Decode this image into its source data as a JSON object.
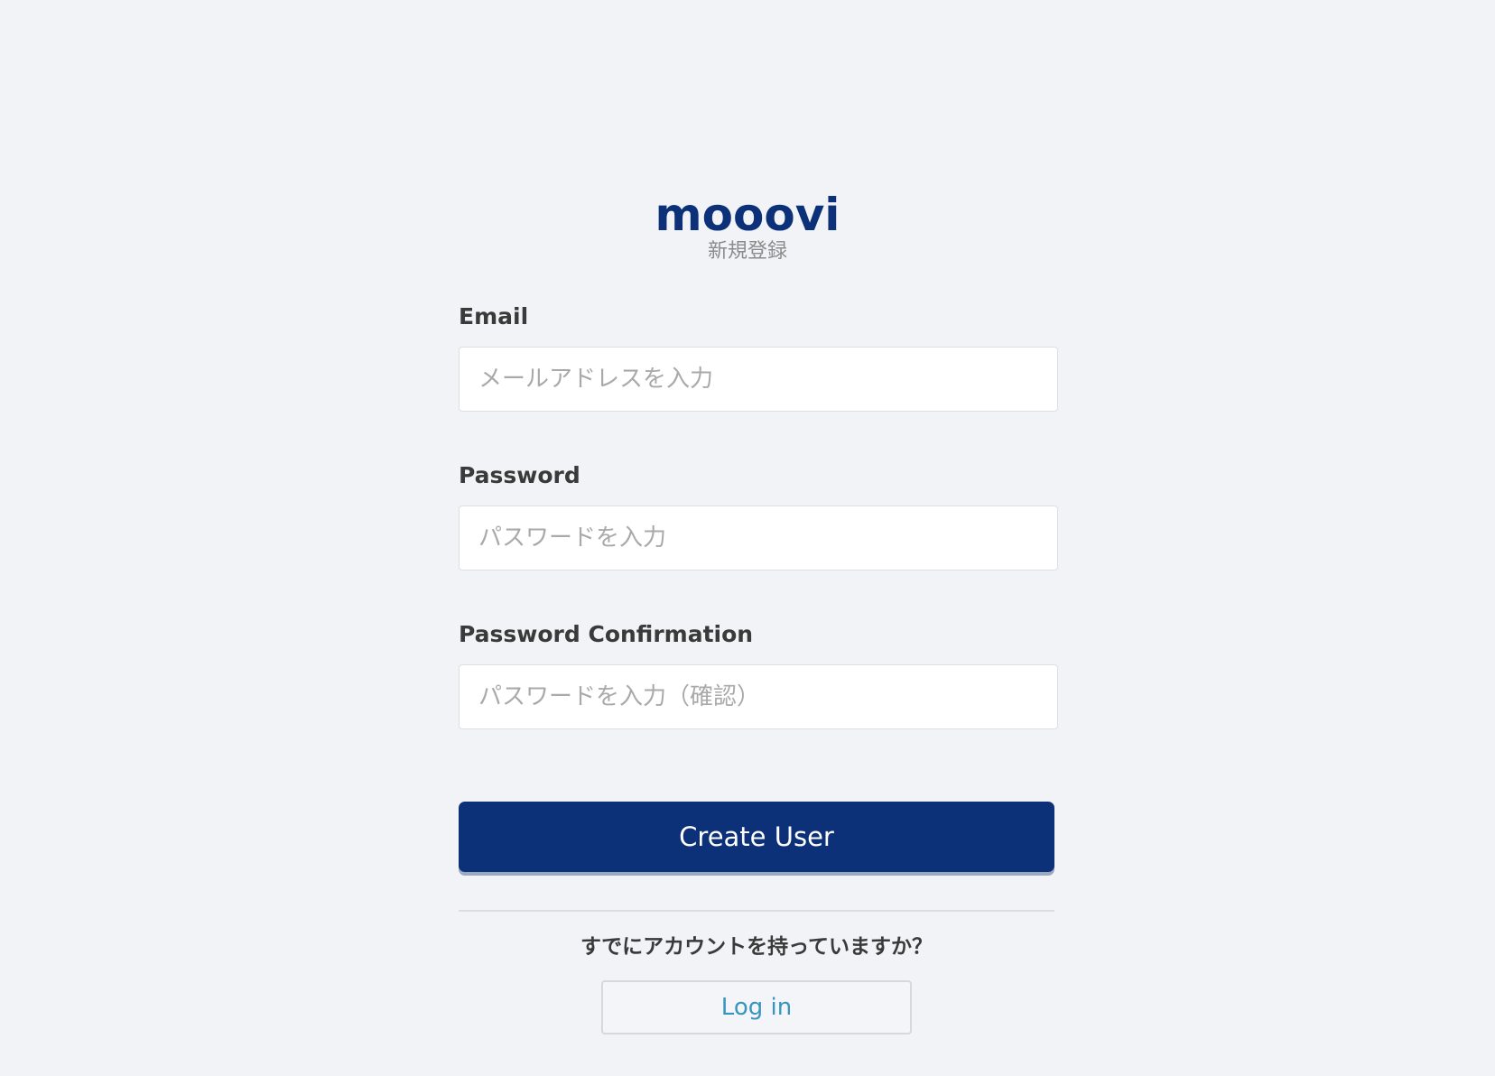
{
  "brand": {
    "logo_text": "mooovi",
    "page_subtitle": "新規登録",
    "primary_color": "#0d3178",
    "link_color": "#3796bf",
    "background_color": "#f2f3f7"
  },
  "form": {
    "email": {
      "label": "Email",
      "placeholder": "メールアドレスを入力",
      "value": ""
    },
    "password": {
      "label": "Password",
      "placeholder": "パスワードを入力",
      "value": ""
    },
    "password_confirmation": {
      "label": "Password Confirmation",
      "placeholder": "パスワードを入力（確認）",
      "value": ""
    },
    "submit_label": "Create User"
  },
  "login_prompt": {
    "text": "すでにアカウントを持っていますか？",
    "button_label": "Log in"
  }
}
